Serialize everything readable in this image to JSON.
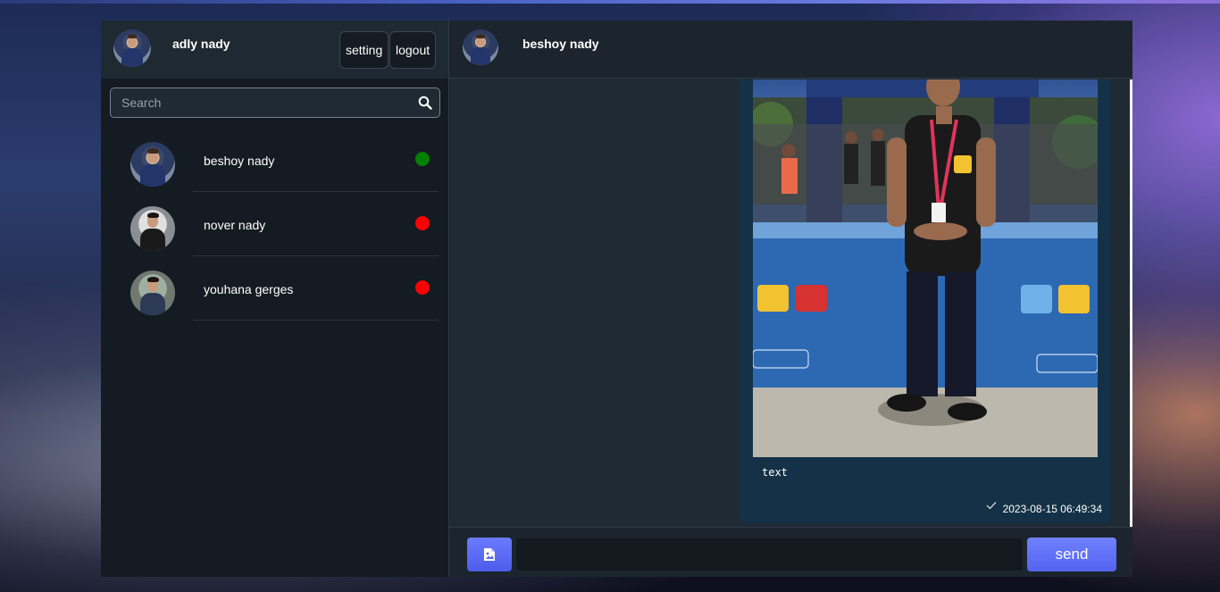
{
  "current_user": {
    "name": "adly nady"
  },
  "header_buttons": {
    "setting": "setting",
    "logout": "logout"
  },
  "search": {
    "placeholder": "Search"
  },
  "contacts": [
    {
      "name": "beshoy nady",
      "status": "online",
      "status_color": "#008000"
    },
    {
      "name": "nover nady",
      "status": "offline",
      "status_color": "#ff0000"
    },
    {
      "name": "youhana gerges",
      "status": "offline",
      "status_color": "#ff0000"
    }
  ],
  "chat": {
    "peer_name": "beshoy nady",
    "messages": [
      {
        "image": "photo",
        "text": "text",
        "time": "2023-08-15 06:49:34",
        "read_icon": "check-icon"
      }
    ]
  },
  "composer": {
    "send_label": "send",
    "image_icon": "image-icon"
  },
  "colors": {
    "accent": "#5d6df5",
    "online": "#008000",
    "offline": "#ff0000"
  }
}
